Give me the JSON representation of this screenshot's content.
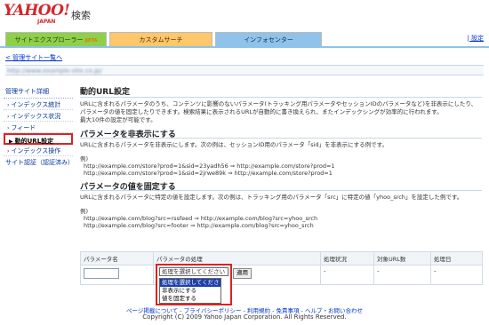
{
  "header": {
    "logo": "YAHOO!",
    "logo_sub": "JAPAN",
    "service": "検索",
    "tabs": [
      {
        "label": "サイトエクスプローラー",
        "badge": "βETA"
      },
      {
        "label": "カスタムサーチ"
      },
      {
        "label": "インフォセンター"
      }
    ],
    "settings_link": "設定"
  },
  "breadcrumb": "< 管理サイト一覧へ",
  "site_url": "http://www.example-site.co.jp/",
  "sidebar": {
    "heading": "管理サイト詳細",
    "items": [
      {
        "label": "インデックス統計"
      },
      {
        "label": "インデックス状況"
      },
      {
        "label": "フィード"
      },
      {
        "label": "動的URL設定"
      },
      {
        "label": "インデックス操作"
      }
    ],
    "cert": "サイト認証（認証済み）"
  },
  "main": {
    "title": "動的URL設定",
    "intro": "URLに含まれるパラメータのうち、コンテンツに影響のないパラメータ(トラッキング用パラメータやセッションIDのパラメータなど)を非表示にしたり、パラメータの値を固定したりできます。検索結果に表示されるURLが自動的に書き換えられ、またインデックシングが効率的に行われます。",
    "limit_note": "最大10件の設定が可能です。",
    "section1": {
      "heading": "パラメータを非表示にする",
      "desc": "URLに含まれるパラメータを非表示にします。次の例は、セッションID用のパラメータ「sid」を非表示にする例です。",
      "example_label": "例)",
      "examples": [
        "http://example.com/store?prod=1&sid=23yadh56  ⇒  http://example.com/store?prod=1",
        "http://example.com/store?prod=1&sid=2jrwe89k  ⇒  http://example.com/store?prod=1"
      ]
    },
    "section2": {
      "heading": "パラメータの値を固定する",
      "desc": "URLに含まれるパラメータに特定の値を設定します。次の例は、トラッキング用のパラメータ「src」に特定の値「yhoo_srch」を設定した例です。",
      "example_label": "例)",
      "examples": [
        "http://example.com/blog?src=rssfeed  ⇒  http://example.com/blog?src=yhoo_srch",
        "http://example.com/blog?src=footer  ⇒  http://example.com/blog?src=yhoo_srch"
      ]
    }
  },
  "table": {
    "headers": [
      "パラメータ名",
      "パラメータの処理",
      "処理状況",
      "対象URL数",
      "処理日"
    ],
    "select_value": "処理を選択してください",
    "apply_button": "適用",
    "status": "-",
    "url_count": "-",
    "date": "-",
    "dropdown_options": [
      "処理を選択してください",
      "非表示にする",
      "値を固定する"
    ]
  },
  "footer": {
    "links": "ページ掲載について - プライバシーポリシー - 利用規約 - 免責事項 - ヘルプ・お問い合わせ",
    "copyright": "Copyright (C) 2009 Yahoo Japan Corporation. All Rights Reserved."
  }
}
